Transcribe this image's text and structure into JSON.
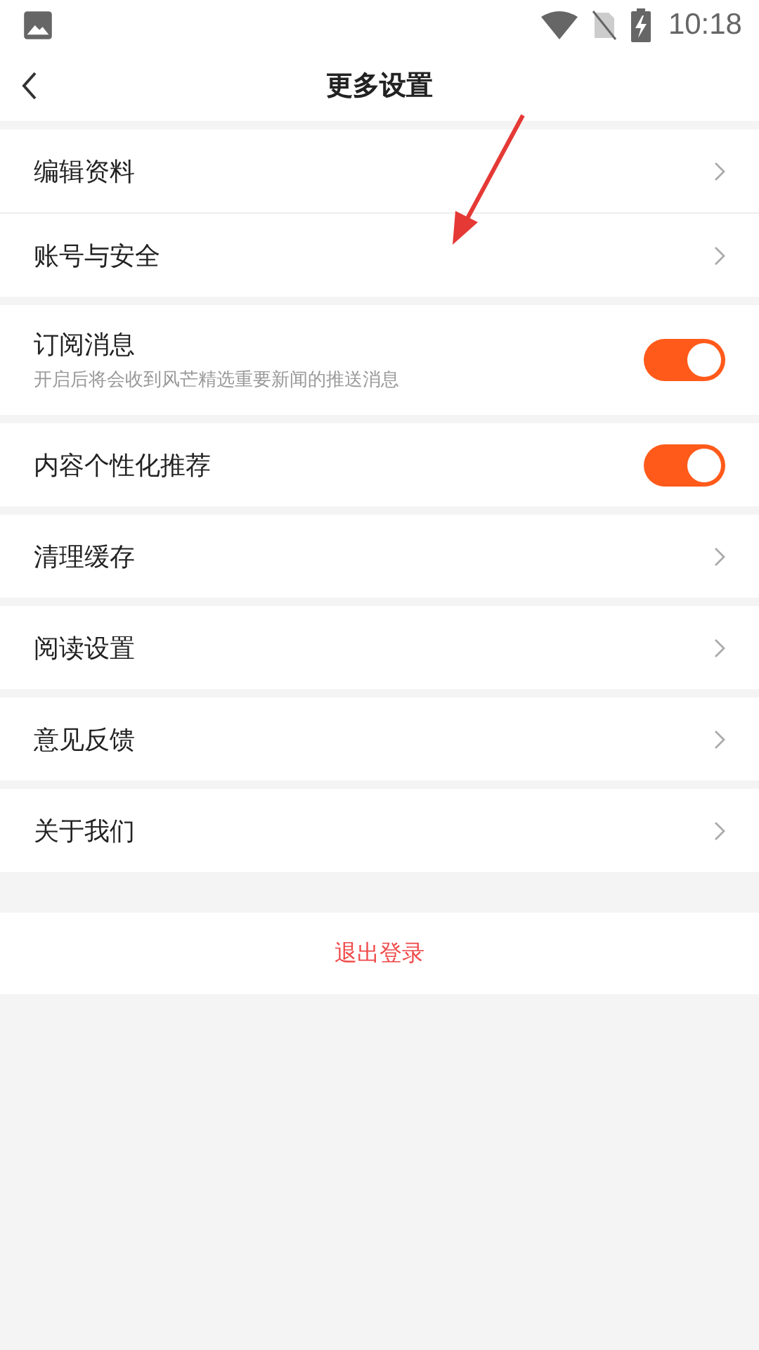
{
  "status_bar": {
    "time": "10:18"
  },
  "header": {
    "title": "更多设置"
  },
  "sections": [
    {
      "rows": [
        {
          "kind": "link",
          "label": "编辑资料"
        },
        {
          "kind": "link",
          "label": "账号与安全"
        }
      ]
    },
    {
      "rows": [
        {
          "kind": "toggle",
          "label": "订阅消息",
          "description": "开启后将会收到风芒精选重要新闻的推送消息",
          "on": true
        }
      ]
    },
    {
      "rows": [
        {
          "kind": "toggle",
          "label": "内容个性化推荐",
          "on": true
        }
      ]
    },
    {
      "rows": [
        {
          "kind": "link",
          "label": "清理缓存"
        }
      ]
    },
    {
      "rows": [
        {
          "kind": "link",
          "label": "阅读设置"
        }
      ]
    },
    {
      "rows": [
        {
          "kind": "link",
          "label": "意见反馈"
        }
      ]
    },
    {
      "rows": [
        {
          "kind": "link",
          "label": "关于我们"
        }
      ]
    }
  ],
  "logout": {
    "label": "退出登录"
  }
}
